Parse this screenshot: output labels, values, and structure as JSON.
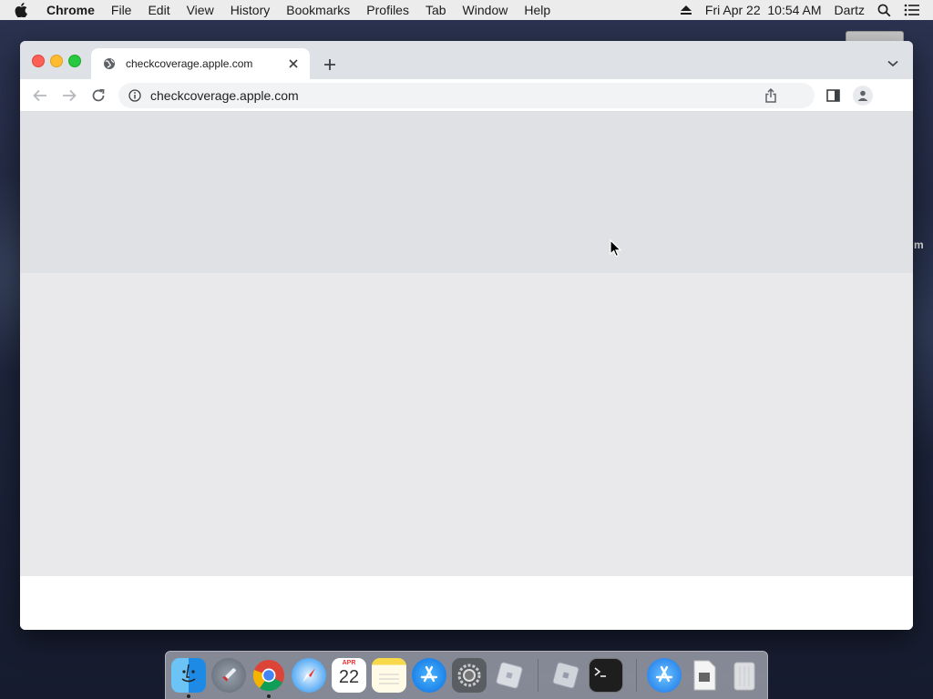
{
  "menubar": {
    "app_name": "Chrome",
    "items": [
      "File",
      "Edit",
      "View",
      "History",
      "Bookmarks",
      "Profiles",
      "Tab",
      "Window",
      "Help"
    ],
    "clock": "Fri Apr 22  10:54 AM",
    "user": "Dartz"
  },
  "desktop": {
    "partial_label": "m"
  },
  "browser": {
    "tab_title": "checkcoverage.apple.com",
    "url": "checkcoverage.apple.com"
  },
  "dock": {
    "apps": [
      {
        "name": "Finder",
        "icon": "finder-icon",
        "running": true
      },
      {
        "name": "Launchpad",
        "icon": "launchpad-icon",
        "running": false
      },
      {
        "name": "Google Chrome",
        "icon": "chrome-icon",
        "running": true
      },
      {
        "name": "Safari",
        "icon": "safari-icon",
        "running": false
      },
      {
        "name": "Calendar",
        "icon": "calendar-icon",
        "running": false,
        "month": "APR",
        "day": "22"
      },
      {
        "name": "Notes",
        "icon": "notes-icon",
        "running": false
      },
      {
        "name": "App Store",
        "icon": "app-store-icon",
        "running": false
      },
      {
        "name": "System Preferences",
        "icon": "system-preferences-icon",
        "running": false
      },
      {
        "name": "Roblox",
        "icon": "roblox-icon",
        "running": false
      },
      {
        "name": "Roblox Studio",
        "icon": "roblox-studio-icon",
        "running": false
      },
      {
        "name": "Terminal",
        "icon": "terminal-icon",
        "running": false
      },
      {
        "name": "Applications",
        "icon": "applications-folder-icon",
        "running": false
      },
      {
        "name": "Document",
        "icon": "document-icon",
        "running": false
      },
      {
        "name": "Trash",
        "icon": "trash-icon",
        "running": false
      }
    ]
  },
  "colors": {
    "chrome_tabstrip": "#dee1e6",
    "omnibox_bg": "#f1f3f4",
    "content_band_top": "#dfe1e5",
    "content_band_mid": "#e9e9eb"
  }
}
